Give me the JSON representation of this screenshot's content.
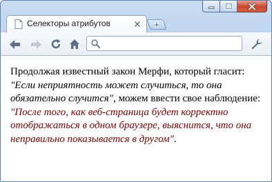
{
  "window": {
    "controls": {
      "minimize_icon": "minimize-icon",
      "maximize_icon": "maximize-icon",
      "close_icon": "close-icon"
    }
  },
  "tabs": [
    {
      "title": "Селекторы атрибутов",
      "active": true
    }
  ],
  "toolbar": {
    "omnibox": {
      "value": "",
      "placeholder": ""
    }
  },
  "content": {
    "text1": "Продолжая известный закон Мерфи, который гласит: ",
    "quote1": "\"Если неприятность может случиться, то она обязательно случится\"",
    "text2": ", можем ввести свое наблюдение: ",
    "quote2": "\"После того, как веб-страница будет корректно отображаться в одном браузере, выяснится, что она неправильно показывается в другом\"",
    "text3": "."
  },
  "colors": {
    "quote2": "#7a0000",
    "frame": "#a9c6ea",
    "close_button": "#c9452e"
  }
}
